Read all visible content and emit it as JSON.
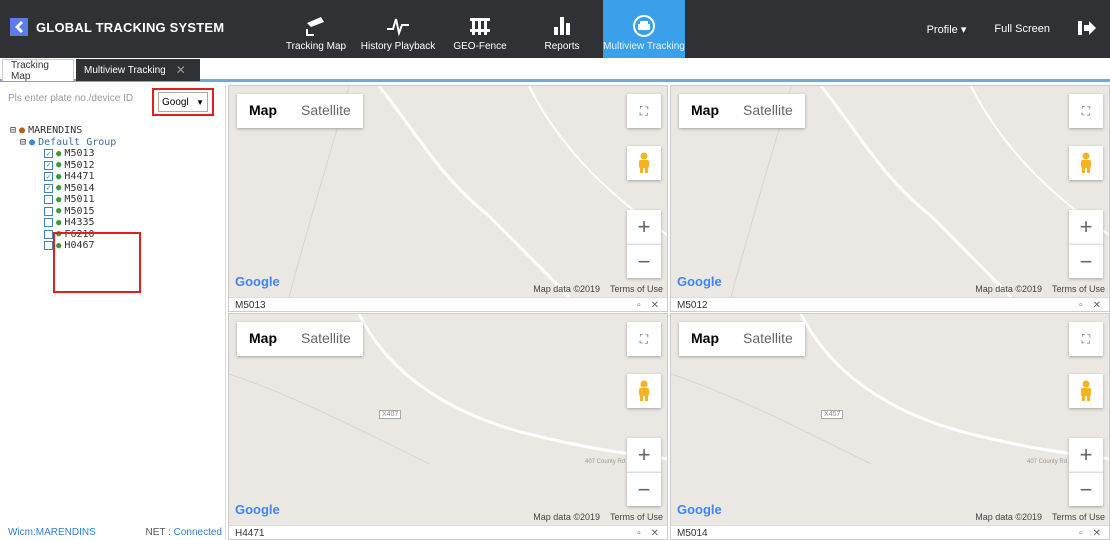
{
  "app": {
    "title": "GLOBAL TRACKING SYSTEM"
  },
  "nav": [
    {
      "label": "Tracking Map",
      "icon": "camera-icon",
      "active": false
    },
    {
      "label": "History Playback",
      "icon": "waveform-icon",
      "active": false
    },
    {
      "label": "GEO-Fence",
      "icon": "fence-icon",
      "active": false
    },
    {
      "label": "Reports",
      "icon": "bar-chart-icon",
      "active": false
    },
    {
      "label": "Multiview Tracking",
      "icon": "car-icon",
      "active": true
    }
  ],
  "topright": {
    "profile": "Profile ▾",
    "fullscreen": "Full Screen",
    "logout_icon": "logout-icon"
  },
  "tabs": {
    "tab1": "Tracking Map",
    "tab2": "Multiview Tracking",
    "close": "✕"
  },
  "sidebar": {
    "search_placeholder": "Pls enter plate no./device ID",
    "map_provider": "Googl",
    "root": "MARENDINS",
    "group": "Default Group",
    "vehicles": [
      {
        "id": "M5013",
        "checked": true
      },
      {
        "id": "M5012",
        "checked": true
      },
      {
        "id": "H4471",
        "checked": true
      },
      {
        "id": "M5014",
        "checked": true
      },
      {
        "id": "M5011",
        "checked": false
      },
      {
        "id": "M5015",
        "checked": false
      },
      {
        "id": "H4335",
        "checked": false
      },
      {
        "id": "F6210",
        "checked": false
      },
      {
        "id": "H0467",
        "checked": false
      }
    ],
    "status_user": "Wicm:MARENDINS",
    "status_net_label": "NET : ",
    "status_net": "Connected"
  },
  "map_common": {
    "map": "Map",
    "satellite": "Satellite",
    "google": "Google",
    "map_data": "Map data ©2019",
    "terms": "Terms of Use",
    "road_label": "X407",
    "road_text": "407 County Rd"
  },
  "panes": [
    {
      "title": "M5013"
    },
    {
      "title": "M5012"
    },
    {
      "title": "H4471"
    },
    {
      "title": "M5014"
    }
  ],
  "colors": {
    "topbar": "#2f3134",
    "active_nav": "#3aa0ea",
    "highlight": "#e02020",
    "map_bg": "#ebe8e3"
  }
}
